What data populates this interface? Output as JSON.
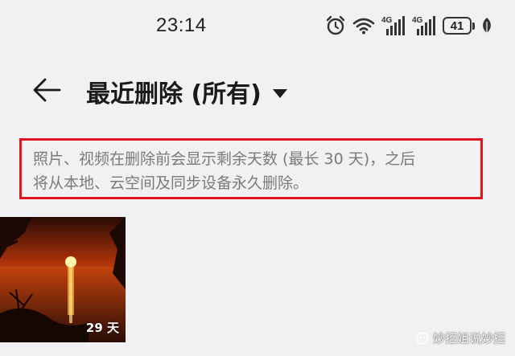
{
  "status_bar": {
    "time": "23:14",
    "net1": "4G",
    "net2": "4G",
    "battery": "41",
    "icons": [
      "alarm-icon",
      "wifi-icon",
      "signal-4g-icon",
      "signal-4g-icon",
      "battery-icon",
      "leaf-icon"
    ]
  },
  "header": {
    "back_icon": "arrow-left-icon",
    "title": "最近删除 (所有)",
    "dropdown_icon": "caret-down-icon"
  },
  "notice": {
    "line1": "照片、视频在删除前会显示剩余天数 (最长 30 天)，之后",
    "line2": "将从本地、云空间及同步设备永久删除。",
    "border_color": "#e0141e"
  },
  "items": [
    {
      "days_left": "29 天",
      "kind": "sunset-photo"
    }
  ],
  "watermark": "妙招姐说妙招"
}
